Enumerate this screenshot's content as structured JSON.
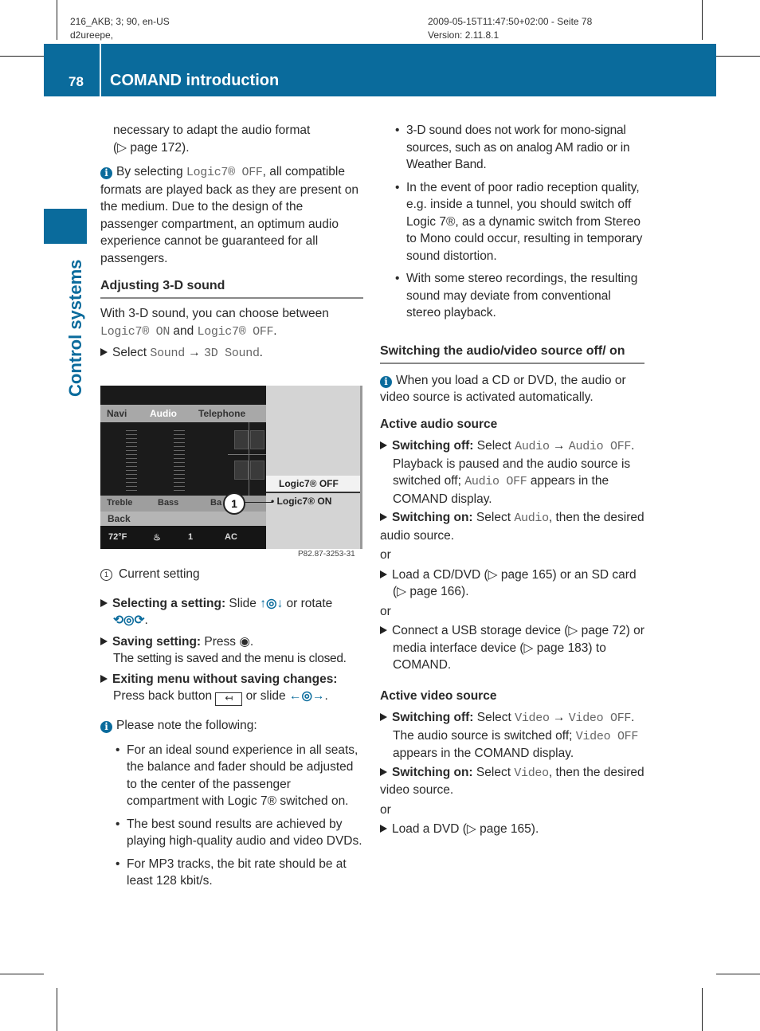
{
  "meta": {
    "left_line1": "216_AKB; 3; 90, en-US",
    "left_line2": "d2ureepe,",
    "right_line1": "2009-05-15T11:47:50+02:00 - Seite 78",
    "right_line2": "Version: 2.11.8.1"
  },
  "header": {
    "page_number": "78",
    "chapter_title": "COMAND introduction",
    "accent_color": "#0a6b9c"
  },
  "side_tab": {
    "label": "Control systems"
  },
  "left_column": {
    "intro": {
      "text": "necessary to adapt the audio format",
      "ref": "(▷ page 172)."
    },
    "info1": {
      "pre": "By selecting ",
      "code": "Logic7® OFF",
      "post": ", all compatible formats are played back as they are present on the medium. Due to the design of the passenger compartment, an optimum audio experience cannot be guaranteed for all passengers."
    },
    "section_heading": "Adjusting 3-D sound",
    "section_intro": {
      "pre": "With 3-D sound, you can choose between ",
      "code1": "Logic7® ON",
      "mid": " and ",
      "code2": "Logic7® OFF",
      "post": "."
    },
    "select_step": {
      "pre": "Select ",
      "code1": "Sound",
      "arrow": "→",
      "code2": "3D Sound",
      "post": "."
    },
    "screen": {
      "tabs": [
        "Navi",
        "Audio",
        "Telephone"
      ],
      "controls": [
        "Treble",
        "Bass",
        "Ba"
      ],
      "back": "Back",
      "status": [
        "72°F",
        "seat",
        "1",
        "AC"
      ],
      "option_off": "Logic7® OFF",
      "option_on": "• Logic7® ON",
      "callout": "1",
      "image_code": "P82.87-3253-31"
    },
    "legend": {
      "number": "1",
      "text": "Current setting"
    },
    "steps": [
      {
        "bold": "Selecting a setting:",
        "text": " Slide ",
        "sym1": "↑◎↓",
        "mid": " or rotate ",
        "sym2": "⟲◎⟳",
        "post": "."
      },
      {
        "bold": "Saving setting:",
        "text": " Press ",
        "sym1": "◉",
        "post": ".",
        "note": "The setting is saved and the menu is closed."
      },
      {
        "bold": "Exiting menu without saving changes:",
        "text": "Press back button ",
        "sym1": "↤",
        "mid": " or slide ",
        "sym2": "←◎→",
        "post": "."
      }
    ],
    "info2": {
      "title": "Please note the following:",
      "bullets": [
        "For an ideal sound experience in all seats, the balance and fader should be adjusted to the center of the passenger compartment with Logic 7® switched on.",
        "The best sound results are achieved by playing high-quality audio and video DVDs.",
        "For MP3 tracks, the bit rate should be at least 128 kbit/s."
      ]
    }
  },
  "right_column": {
    "bullets": [
      "3-D sound does not work for mono-signal sources, such as on analog AM radio or in Weather Band.",
      "In the event of poor radio reception quality, e.g. inside a tunnel, you should switch off Logic 7®, as a dynamic switch from Stereo to Mono could occur, resulting in temporary sound distortion.",
      "With some stereo recordings, the resulting sound may deviate from conventional stereo playback."
    ],
    "section_heading": "Switching the audio/video source off/ on",
    "info": "When you load a CD or DVD, the audio or video source is activated automatically.",
    "audio": {
      "heading": "Active audio source",
      "off": {
        "bold": "Switching off:",
        "pre": " Select ",
        "code1": "Audio",
        "arrow": "→",
        "code2": "Audio OFF",
        "post": ".",
        "note_pre": "Playback is paused and the audio source is switched off; ",
        "note_code": "Audio OFF",
        "note_post": " appears in the COMAND display."
      },
      "on": {
        "bold": "Switching on:",
        "pre": " Select ",
        "code": "Audio",
        "post": ", then the desired audio source."
      },
      "or1": "or",
      "load": "Load a CD/DVD (▷ page 165) or an SD card (▷ page 166).",
      "or2": "or",
      "usb": "Connect a USB storage device (▷ page 72) or media interface device (▷ page 183) to COMAND."
    },
    "video": {
      "heading": "Active video source",
      "off": {
        "bold": "Switching off:",
        "pre": " Select ",
        "code1": "Video",
        "arrow": "→",
        "code2": "Video OFF",
        "post": ".",
        "note_pre": "The audio source is switched off; ",
        "note_code": "Video OFF",
        "note_post": " appears in the COMAND display."
      },
      "on": {
        "bold": "Switching on:",
        "pre": " Select ",
        "code": "Video",
        "post": ", then the desired video source."
      },
      "or": "or",
      "load": "Load a DVD (▷ page 165)."
    }
  }
}
